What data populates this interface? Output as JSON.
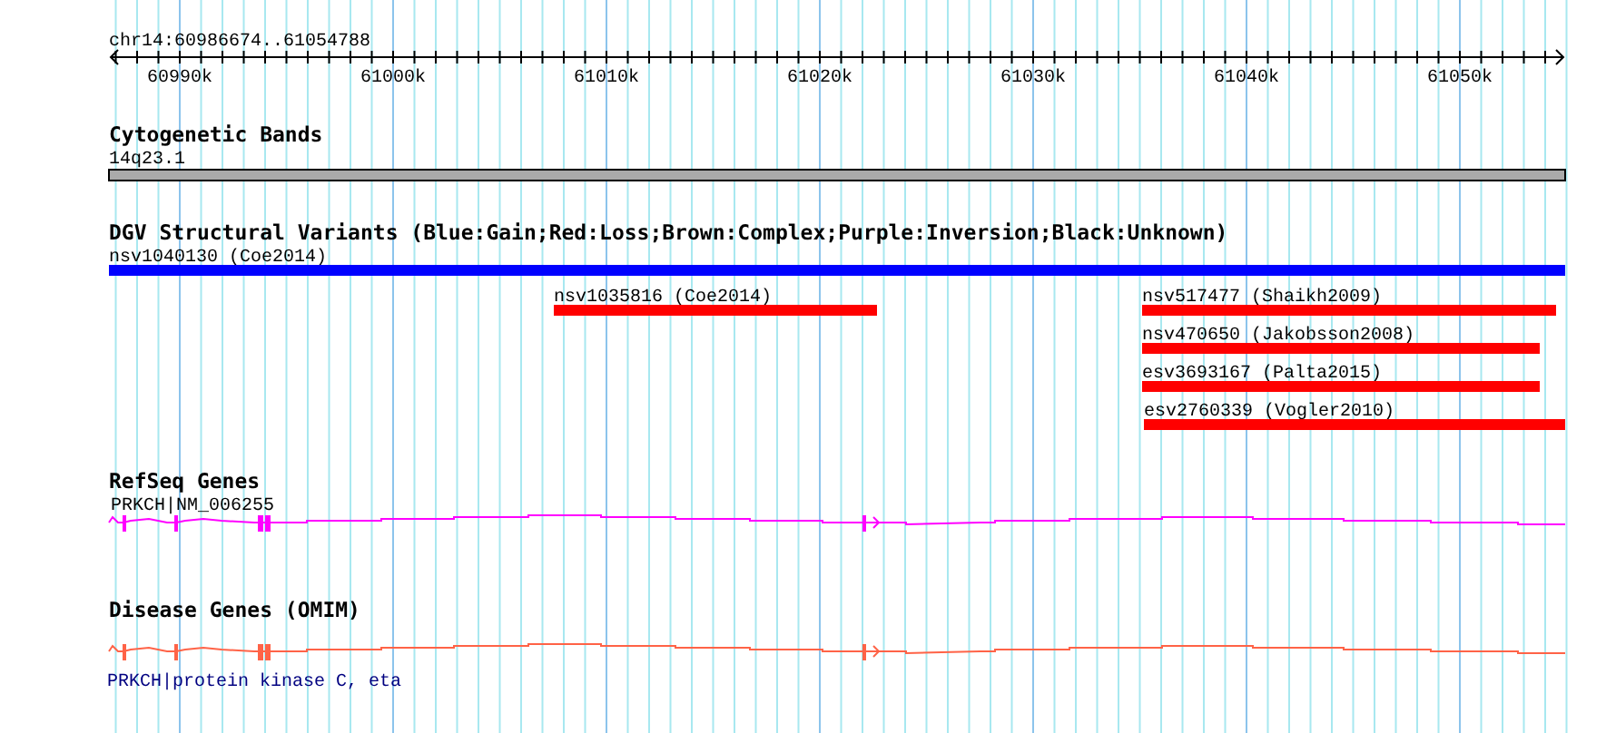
{
  "ruler": {
    "range_label": "chr14:60986674..61054788",
    "ticks": [
      "60990k",
      "61000k",
      "61010k",
      "61020k",
      "61030k",
      "61040k",
      "61050k"
    ]
  },
  "tracks": [
    {
      "kind": "band",
      "title": "Cytogenetic Bands",
      "label": "14q23.1"
    },
    {
      "kind": "variants",
      "title": "DGV Structural Variants (Blue:Gain;Red:Loss;Brown:Complex;Purple:Inversion;Black:Unknown)",
      "features": [
        {
          "label": "nsv1040130 (Coe2014)",
          "color": "#0000ff"
        },
        {
          "label": "nsv1035816 (Coe2014)",
          "color": "#ff0000"
        },
        {
          "label": "nsv517477 (Shaikh2009)",
          "color": "#ff0000"
        },
        {
          "label": "nsv470650 (Jakobsson2008)",
          "color": "#ff0000"
        },
        {
          "label": "esv3693167 (Palta2015)",
          "color": "#ff0000"
        },
        {
          "label": "esv2760339 (Vogler2010)",
          "color": "#ff0000"
        }
      ]
    },
    {
      "kind": "gene",
      "title": "RefSeq Genes",
      "label": "PRKCH|NM_006255",
      "label_below": false,
      "color": "#ff00ff"
    },
    {
      "kind": "gene",
      "title": "Disease Genes (OMIM)",
      "label": "PRKCH|protein kinase C, eta",
      "label_below": true,
      "color": "#ff6347"
    }
  ]
}
